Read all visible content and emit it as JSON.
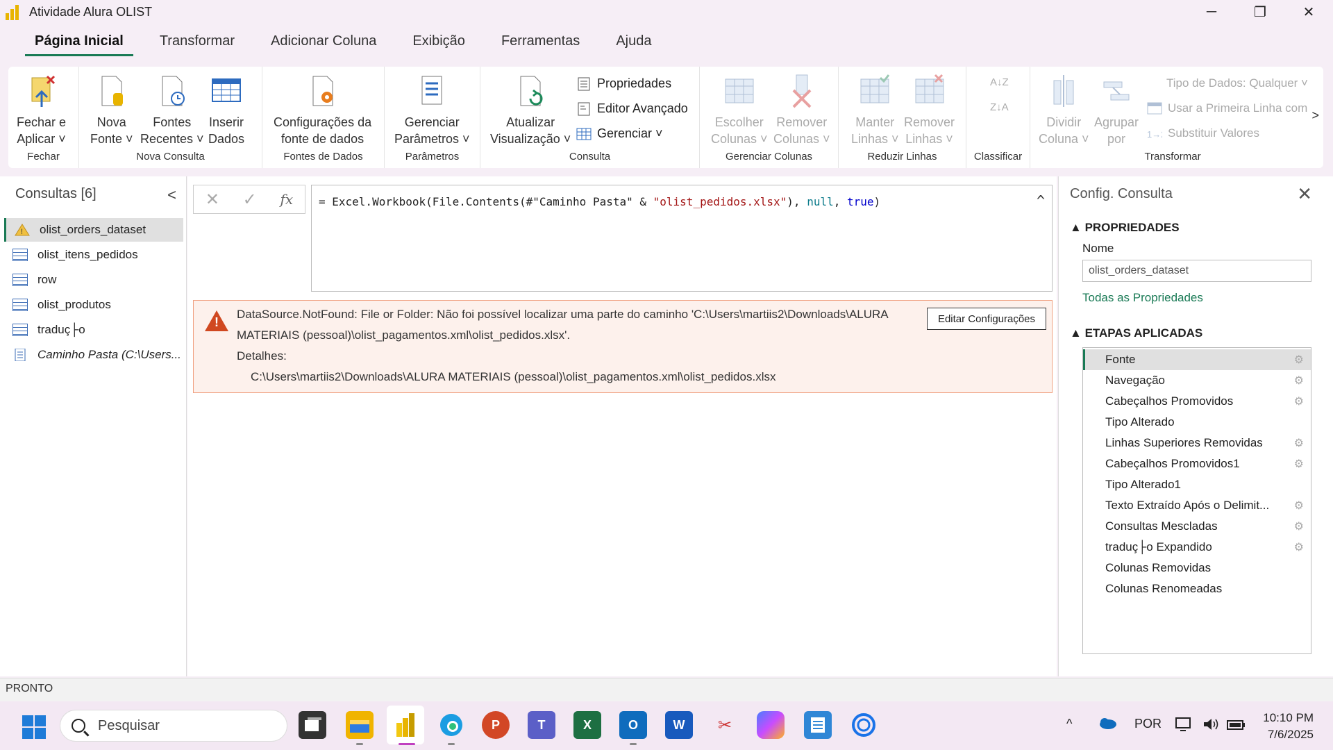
{
  "window": {
    "title": "Atividade Alura OLIST",
    "minimize": "─",
    "restore": "❐",
    "close": "✕"
  },
  "tabs": [
    "Página Inicial",
    "Transformar",
    "Adicionar Coluna",
    "Exibição",
    "Ferramentas",
    "Ajuda"
  ],
  "ribbon": {
    "fechar": {
      "label": "Fechar",
      "btn1": "Fechar e",
      "btn2": "Aplicar ˅"
    },
    "nova_consulta": {
      "label": "Nova Consulta",
      "nova1": "Nova",
      "nova2": "Fonte ˅",
      "fontes1": "Fontes",
      "fontes2": "Recentes ˅",
      "inserir1": "Inserir",
      "inserir2": "Dados"
    },
    "fontes_dados": {
      "label": "Fontes de Dados",
      "cfg1": "Configurações da",
      "cfg2": "fonte de dados"
    },
    "parametros": {
      "label": "Parâmetros",
      "ger1": "Gerenciar",
      "ger2": "Parâmetros ˅"
    },
    "consulta": {
      "label": "Consulta",
      "atu1": "Atualizar",
      "atu2": "Visualização ˅",
      "propriedades": "Propriedades",
      "editor": "Editor Avançado",
      "gerenciar": "Gerenciar ˅"
    },
    "gerenciar_colunas": {
      "label": "Gerenciar Colunas",
      "esc1": "Escolher",
      "esc2": "Colunas ˅",
      "rem1": "Remover",
      "rem2": "Colunas ˅"
    },
    "reduzir_linhas": {
      "label": "Reduzir Linhas",
      "man1": "Manter",
      "man2": "Linhas ˅",
      "rml1": "Remover",
      "rml2": "Linhas ˅"
    },
    "classificar": {
      "label": "Classificar"
    },
    "transformar": {
      "label": "Transformar",
      "div1": "Dividir",
      "div2": "Coluna ˅",
      "agr1": "Agrupar",
      "agr2": "por",
      "tipo": "Tipo de Dados: Qualquer ˅",
      "primeira": "Usar a Primeira Linha com",
      "substituir": "Substituir Valores"
    },
    "more": ">"
  },
  "queries": {
    "title": "Consultas [6]",
    "collapse": "<",
    "items": [
      "olist_orders_dataset",
      "olist_itens_pedidos",
      "row",
      "olist_produtos",
      "traduç├o",
      "Caminho Pasta (C:\\Users..."
    ]
  },
  "formula_bar": {
    "cancel": "✕",
    "confirm": "✓",
    "fx": "fx",
    "p1": "= Excel.Workbook(File.Contents(#\"Caminho Pasta\" & ",
    "p2": "\"olist_pedidos.xlsx\"",
    "p3": "), ",
    "p4": "null",
    "p5": ", ",
    "p6": "true",
    "p7": ")",
    "collapse": "^"
  },
  "error": {
    "line1": "DataSource.NotFound: File or Folder: Não foi possível localizar uma parte do caminho 'C:\\Users\\martiis2\\Downloads\\ALURA",
    "line2": "MATERIAIS (pessoal)\\olist_pagamentos.xml\\olist_pedidos.xlsx'.",
    "line3": "Detalhes:",
    "line4": "C:\\Users\\martiis2\\Downloads\\ALURA MATERIAIS (pessoal)\\olist_pagamentos.xml\\olist_pedidos.xlsx",
    "button": "Editar Configurações"
  },
  "settings": {
    "title": "Config. Consulta",
    "close": "✕",
    "properties_title": "PROPRIEDADES",
    "name_label": "Nome",
    "name_value": "olist_orders_dataset",
    "all_props": "Todas as Propriedades",
    "steps_title": "ETAPAS APLICADAS",
    "steps": [
      "Fonte",
      "Navegação",
      "Cabeçalhos Promovidos",
      "Tipo Alterado",
      "Linhas Superiores Removidas",
      "Cabeçalhos Promovidos1",
      "Tipo Alterado1",
      "Texto Extraído Após o Delimit...",
      "Consultas Mescladas",
      "traduç├o Expandido",
      "Colunas Removidas",
      "Colunas Renomeadas"
    ]
  },
  "status": "PRONTO",
  "taskbar": {
    "search": "Pesquisar",
    "lang": "POR",
    "time": "10:10 PM",
    "date": "7/6/2025",
    "chevron": "^"
  }
}
